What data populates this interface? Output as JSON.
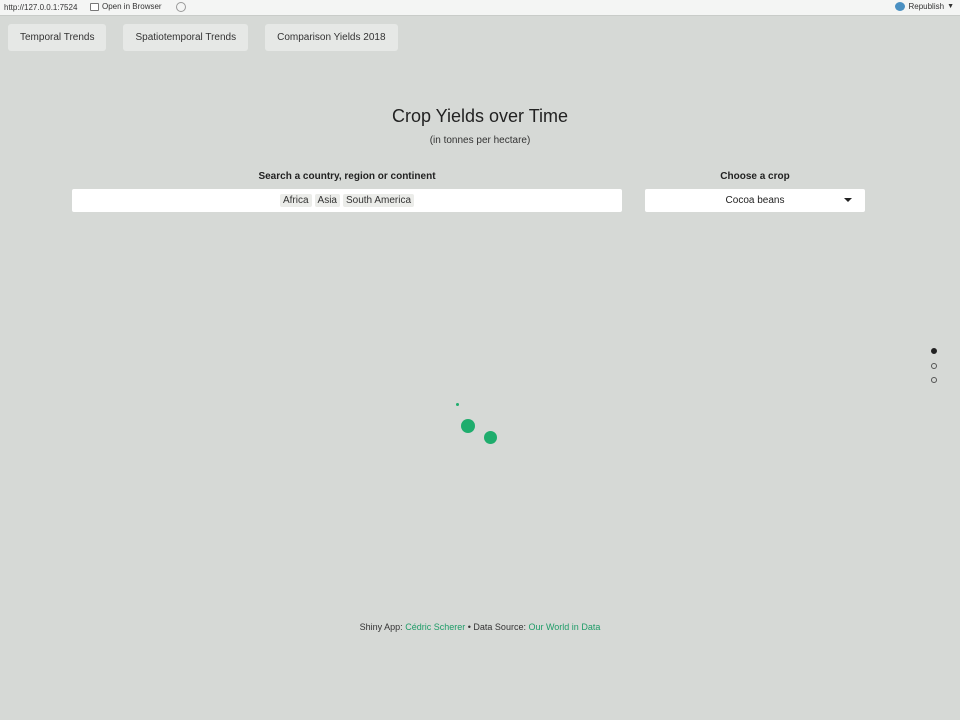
{
  "browser_bar": {
    "url": "http://127.0.0.1:7524",
    "open_in_browser": "Open in Browser",
    "republish": "Republish"
  },
  "tabs": [
    {
      "label": "Temporal Trends"
    },
    {
      "label": "Spatiotemporal Trends"
    },
    {
      "label": "Comparison Yields 2018"
    }
  ],
  "header": {
    "title": "Crop Yields over Time",
    "subtitle": "(in tonnes per hectare)"
  },
  "search": {
    "label": "Search a country, region or continent",
    "selected": [
      "Africa",
      "Asia",
      "South America"
    ]
  },
  "crop_select": {
    "label": "Choose a crop",
    "value": "Cocoa beans"
  },
  "pager": {
    "pages": 3,
    "active_index": 0
  },
  "footer": {
    "shiny_prefix": "Shiny App:",
    "author": "Cédric Scherer",
    "separator": "•",
    "source_prefix": "Data Source:",
    "source": "Our World in Data"
  },
  "colors": {
    "background": "#d6d9d6",
    "accent": "#1fad6d",
    "link": "#1f9c68"
  }
}
